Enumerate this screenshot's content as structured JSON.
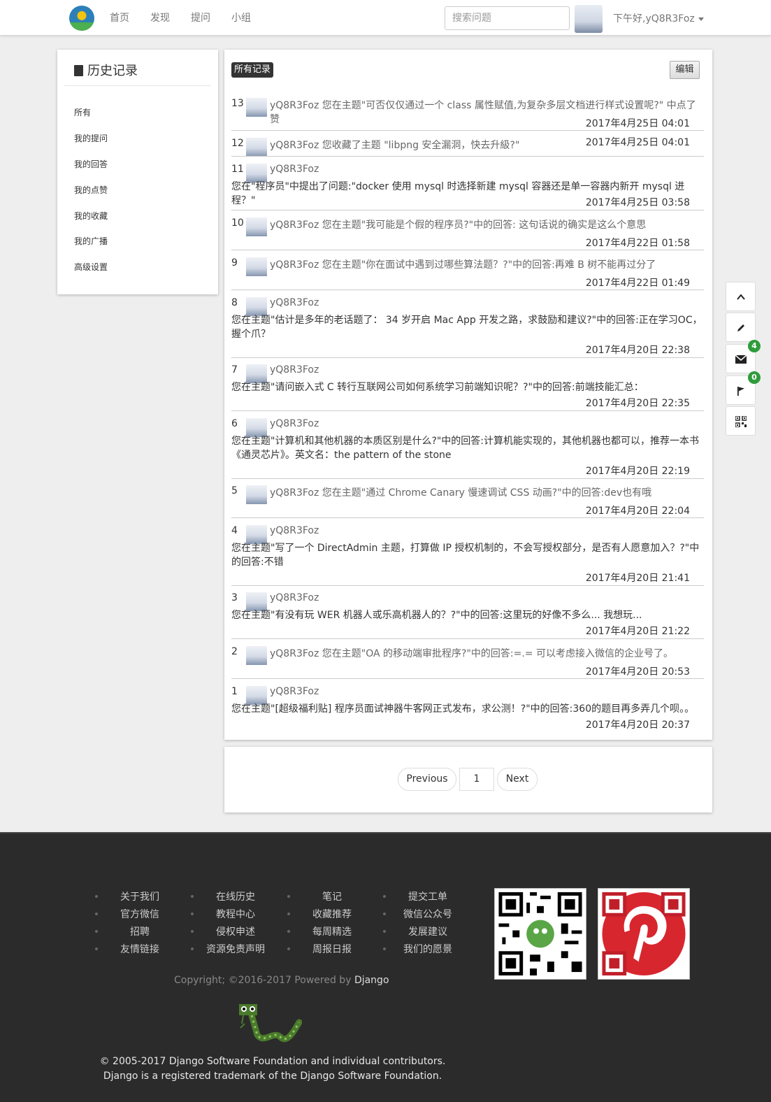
{
  "nav": {
    "links": [
      "首页",
      "发现",
      "提问",
      "小组"
    ],
    "search_placeholder": "搜索问题",
    "greeting": "下午好,yQ8R3Foz"
  },
  "sidebar": {
    "title": "历史记录",
    "items": [
      "所有",
      "我的提问",
      "我的回答",
      "我的点赞",
      "我的收藏",
      "我的广播",
      "高级设置"
    ]
  },
  "main": {
    "filter_label": "所有记录",
    "edit_label": "编辑",
    "records": [
      {
        "num": "13",
        "user": "yQ8R3Foz",
        "text": "您在主题\"可否仅仅通过一个 class 属性赋值,为复杂多层文档进行样式设置呢?\" 中点了赞",
        "date": "2017年4月25日 04:01"
      },
      {
        "num": "12",
        "user": "yQ8R3Foz",
        "text": "您收藏了主题 \"libpng 安全漏洞，快去升級?\"",
        "date": "2017年4月25日 04:01"
      },
      {
        "num": "11",
        "user": "yQ8R3Foz",
        "text": "您在\"程序员\"中提出了问题:\"docker 使用 mysql 时选择新建 mysql 容器还是单一容器内新开 mysql 进程？\"",
        "date": "2017年4月25日 03:58"
      },
      {
        "num": "10",
        "user": "yQ8R3Foz",
        "text": "您在主题\"我可能是个假的程序员?\"中的回答: 这句话说的确实是这么个意思",
        "date": "2017年4月22日 01:58"
      },
      {
        "num": "9",
        "user": "yQ8R3Foz",
        "text": "您在主题\"你在面试中遇到过哪些算法题？?\"中的回答:再难 B 树不能再过分了",
        "date": "2017年4月22日 01:49"
      },
      {
        "num": "8",
        "user": "yQ8R3Foz",
        "text": "您在主题\"估计是多年的老话题了： 34 岁开启 Mac App 开发之路，求鼓励和建议?\"中的回答:正在学习OC，握个爪？",
        "date": "2017年4月20日 22:38"
      },
      {
        "num": "7",
        "user": "yQ8R3Foz",
        "text": "您在主题\"请问嵌入式 C 转行互联网公司如何系统学习前端知识呢？?\"中的回答:前端技能汇总：",
        "date": "2017年4月20日 22:35"
      },
      {
        "num": "6",
        "user": "yQ8R3Foz",
        "text": "您在主题\"计算机和其他机器的本质区别是什么?\"中的回答:计算机能实现的，其他机器也都可以，推荐一本书《通灵芯片》。英文名：the pattern of the stone",
        "date": "2017年4月20日 22:19"
      },
      {
        "num": "5",
        "user": "yQ8R3Foz",
        "text": "您在主题\"通过 Chrome Canary 慢速调试 CSS 动画?\"中的回答:dev也有哦",
        "date": "2017年4月20日 22:04"
      },
      {
        "num": "4",
        "user": "yQ8R3Foz",
        "text": "您在主题\"写了一个 DirectAdmin 主题，打算做 IP 授权机制的，不会写授权部分，是否有人愿意加入？?\"中的回答:不错",
        "date": "2017年4月20日 21:41"
      },
      {
        "num": "3",
        "user": "yQ8R3Foz",
        "text": "您在主题\"有没有玩 WER 机器人或乐高机器人的？?\"中的回答:这里玩的好像不多么... 我想玩...",
        "date": "2017年4月20日 21:22"
      },
      {
        "num": "2",
        "user": "yQ8R3Foz",
        "text": "您在主题\"OA 的移动端审批程序?\"中的回答:=.= 可以考虑接入微信的企业号了。",
        "date": "2017年4月20日 20:53"
      },
      {
        "num": "1",
        "user": "yQ8R3Foz",
        "text": "您在主题\"[超级福利贴] 程序员面试神器牛客网正式发布，求公测！?\"中的回答:360的题目再多弄几个呗。。",
        "date": "2017年4月20日 20:37"
      }
    ]
  },
  "pager": {
    "prev": "Previous",
    "page": "1",
    "next": "Next"
  },
  "tools": {
    "mail_count": "4",
    "flag_count": "0"
  },
  "footer": {
    "columns": [
      [
        "关于我们",
        "官方微信",
        "招聘",
        "友情链接"
      ],
      [
        "在线历史",
        "教程中心",
        "侵权申述",
        "资源免责声明"
      ],
      [
        "笔记",
        "收藏推荐",
        "每周精选",
        "周报日报"
      ],
      [
        "提交工单",
        "微信公众号",
        "发展建议",
        "我们的愿景"
      ]
    ],
    "copyright_prefix": "Copyright; ©2016-2017 Powered by ",
    "copyright_brand": "Django",
    "django_note": "© 2005-2017 Django Software Foundation and individual contributors. Django is a registered trademark of the Django Software Foundation."
  }
}
